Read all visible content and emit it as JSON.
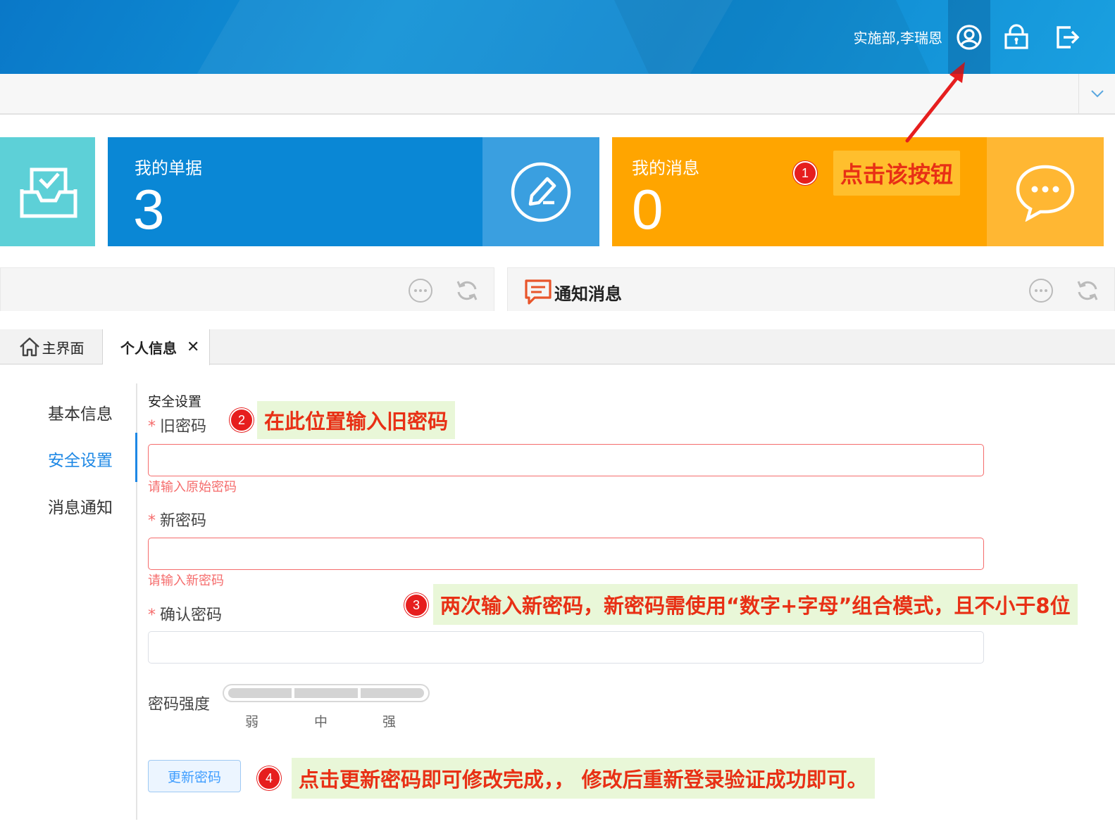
{
  "header": {
    "user": "实施部,李瑞恩",
    "buttons": [
      {
        "name": "user-center-icon"
      },
      {
        "name": "lock-icon"
      },
      {
        "name": "logout-icon"
      }
    ]
  },
  "cards": {
    "documents": {
      "title": "我的单据",
      "count": "3"
    },
    "messages": {
      "title": "我的消息",
      "count": "0"
    }
  },
  "panels": {
    "notice_title": "通知消息"
  },
  "tabs": {
    "home": "主界面",
    "profile": "个人信息",
    "close": "✕"
  },
  "side_nav": {
    "items": [
      {
        "label": "基本信息",
        "active": false
      },
      {
        "label": "安全设置",
        "active": true
      },
      {
        "label": "消息通知",
        "active": false
      }
    ]
  },
  "form": {
    "section_title": "安全设置",
    "required_mark": "*",
    "old_password": {
      "label": "旧密码",
      "value": "",
      "error": "请输入原始密码"
    },
    "new_password": {
      "label": "新密码",
      "value": "",
      "error": "请输入新密码"
    },
    "confirm_password": {
      "label": "确认密码",
      "value": ""
    },
    "strength": {
      "label": "密码强度",
      "levels": [
        "弱",
        "中",
        "强"
      ],
      "level": 0
    },
    "submit": "更新密码"
  },
  "annotations": [
    {
      "num": "1",
      "text": "点击该按钮"
    },
    {
      "num": "2",
      "text": "在此位置输入旧密码"
    },
    {
      "num": "3",
      "text": "两次输入新密码，新密码需使用“数字+字母”组合模式，且不小于8位"
    },
    {
      "num": "4",
      "text": "点击更新密码即可修改完成，，  修改后重新登录验证成功即可。"
    }
  ],
  "colors": {
    "header": "#1192d6",
    "card_blue": "#0a87d5",
    "card_orange": "#ffa500",
    "card_teal": "#5dd0d7",
    "accent": "#1e88e5",
    "error": "#f56c6c",
    "annotation": "#e83015"
  }
}
